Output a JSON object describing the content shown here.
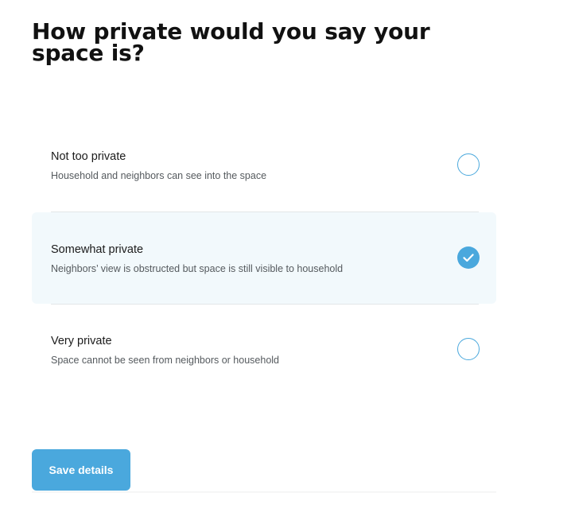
{
  "question": {
    "title": "How private would you say your space is?"
  },
  "options": [
    {
      "title": "Not too private",
      "description": "Household and neighbors can see into the space",
      "selected": false
    },
    {
      "title": "Somewhat private",
      "description": "Neighbors’ view is obstructed but space is still visible to household",
      "selected": true
    },
    {
      "title": "Very private",
      "description": "Space cannot be seen from neighbors or household",
      "selected": false
    }
  ],
  "actions": {
    "save_label": "Save details"
  },
  "colors": {
    "accent": "#4aa8dd",
    "selected_background": "#f2f9fc"
  },
  "icons": {
    "unchecked": "radio-empty-icon",
    "checked": "checkmark-icon"
  }
}
